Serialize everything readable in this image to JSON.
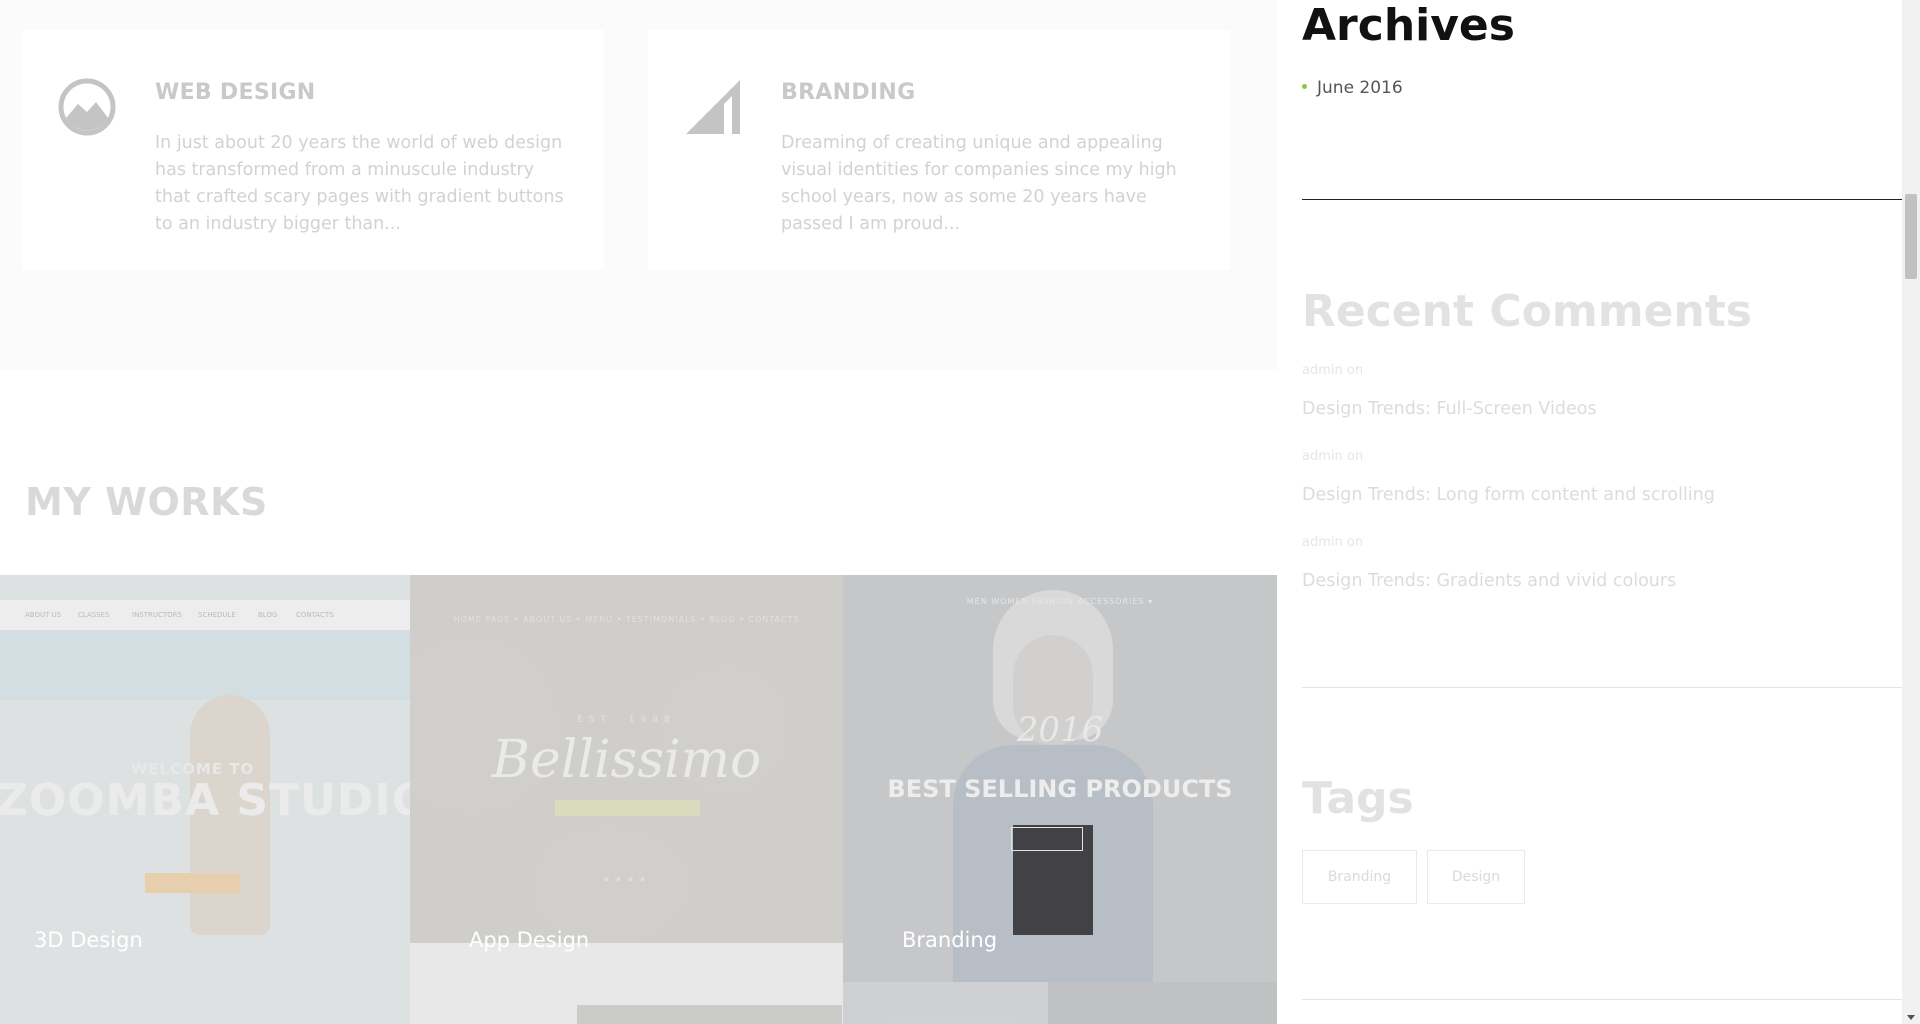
{
  "services": [
    {
      "title": "WEB DESIGN",
      "icon": "mountain-circle-icon",
      "text": "In just about 20 years the world of web design has transformed from a minuscule industry that crafted scary pages with gradient buttons to an industry bigger than..."
    },
    {
      "title": "BRANDING",
      "icon": "triangle-signal-icon",
      "text": "Dreaming of creating unique and appealing visual identities for companies since my high school years, now as some 20 years have passed I am proud..."
    }
  ],
  "works": {
    "heading": "MY WORKS",
    "items": [
      {
        "label": "3D Design",
        "nav": [
          "ABOUT US",
          "CLASSES",
          "INSTRUCTORS",
          "SCHEDULE",
          "BLOG",
          "CONTACTS"
        ],
        "welcome": "WELCOME TO",
        "studio": "ZOOMBA STUDIO"
      },
      {
        "label": "App Design",
        "nav": "HOME PAGE  •  ABOUT US  •  MENU  •  TESTIMONIALS  •  BLOG  •  CONTACTS",
        "estab": "EST.          1988",
        "script": "Bellissimo",
        "stars": "★★★★"
      },
      {
        "label": "Branding",
        "nav": "MEN     WOMEN     FASHION     ACCESSORIES ▾",
        "year": "2016",
        "headline": "BEST SELLING PRODUCTS"
      }
    ]
  },
  "sidebar": {
    "archives": {
      "title": "Archives",
      "items": [
        "June 2016"
      ],
      "bullet_color": "#8cc63f"
    },
    "recent_comments": {
      "title": "Recent Comments",
      "items": [
        {
          "author": "admin on",
          "post": "Design Trends: Full-Screen Videos"
        },
        {
          "author": "admin on",
          "post": "Design Trends: Long form content and scrolling"
        },
        {
          "author": "admin on",
          "post": "Design Trends: Gradients and vivid colours"
        }
      ]
    },
    "tags": {
      "title": "Tags",
      "items": [
        "Branding",
        "Design"
      ]
    }
  }
}
